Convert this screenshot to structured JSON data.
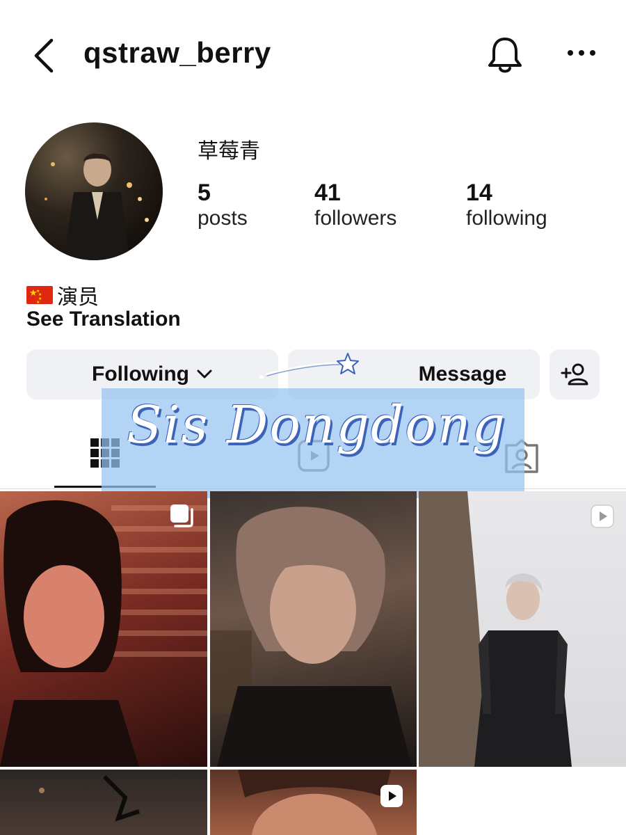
{
  "header": {
    "username": "qstraw_berry",
    "back_icon": "chevron-left-icon",
    "bell_icon": "bell-icon",
    "more_icon": "more-horizontal-icon"
  },
  "profile": {
    "display_name": "草莓青",
    "stats": [
      {
        "value": "5",
        "label": "posts"
      },
      {
        "value": "41",
        "label": "followers"
      },
      {
        "value": "14",
        "label": "following"
      }
    ],
    "bio": "演员",
    "bio_flag": "china-flag",
    "see_translation": "See Translation"
  },
  "actions": {
    "following_label": "Following",
    "message_label": "Message",
    "add_person_icon": "add-person-icon"
  },
  "tabs": [
    "grid-icon",
    "reels-icon",
    "tagged-icon"
  ],
  "overlay": {
    "text": "Sis Dongdong",
    "color": "#96c4f0"
  },
  "grid": [
    {
      "type": "carousel",
      "icon": "carousel-icon"
    },
    {
      "type": "photo"
    },
    {
      "type": "video",
      "icon": "reel-icon"
    },
    {
      "type": "photo"
    },
    {
      "type": "video",
      "icon": "reel-icon"
    }
  ]
}
